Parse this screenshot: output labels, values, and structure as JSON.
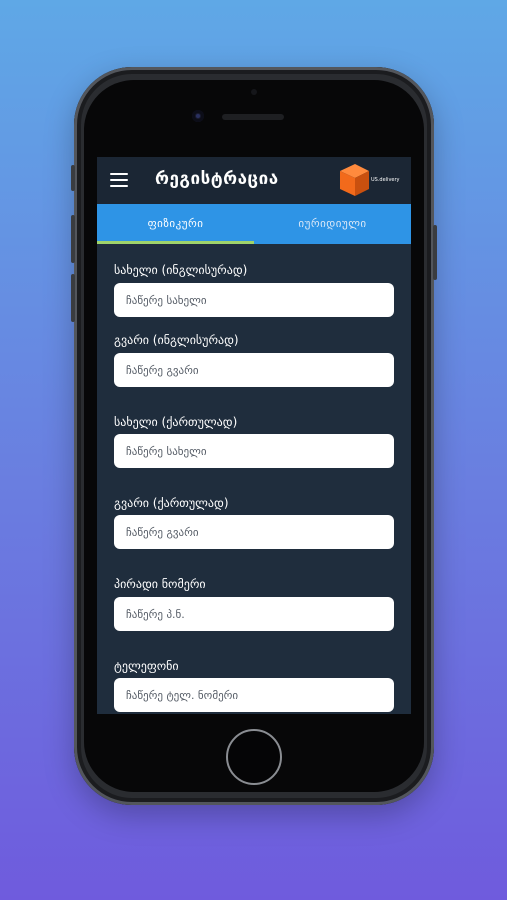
{
  "app": {
    "title": "რეგისტრაცია",
    "logo_text": "US.delivery"
  },
  "tabs": [
    {
      "label": "ფიზიკური",
      "active": true
    },
    {
      "label": "იურიდიული",
      "active": false
    }
  ],
  "form": {
    "fields": [
      {
        "label": "სახელი (ინგლისურად)",
        "placeholder": "ჩაწერე სახელი"
      },
      {
        "label": "გვარი (ინგლისურად)",
        "placeholder": "ჩაწერე გვარი"
      },
      {
        "label": "სახელი (ქართულად)",
        "placeholder": "ჩაწერე სახელი"
      },
      {
        "label": "გვარი (ქართულად)",
        "placeholder": "ჩაწერე გვარი"
      },
      {
        "label": "პირადი ნომერი",
        "placeholder": "ჩაწერე პ.ნ."
      },
      {
        "label": "ტელეფონი",
        "placeholder": "ჩაწერე ტელ. ნომერი"
      }
    ]
  },
  "colors": {
    "background_top": "#5fa8e6",
    "background_bottom": "#6f5bdd",
    "screen_bg": "#1f2d3d",
    "tab_bar": "#2e94e6",
    "tab_indicator": "#9fd36a",
    "logo_orange": "#f26a1b"
  }
}
